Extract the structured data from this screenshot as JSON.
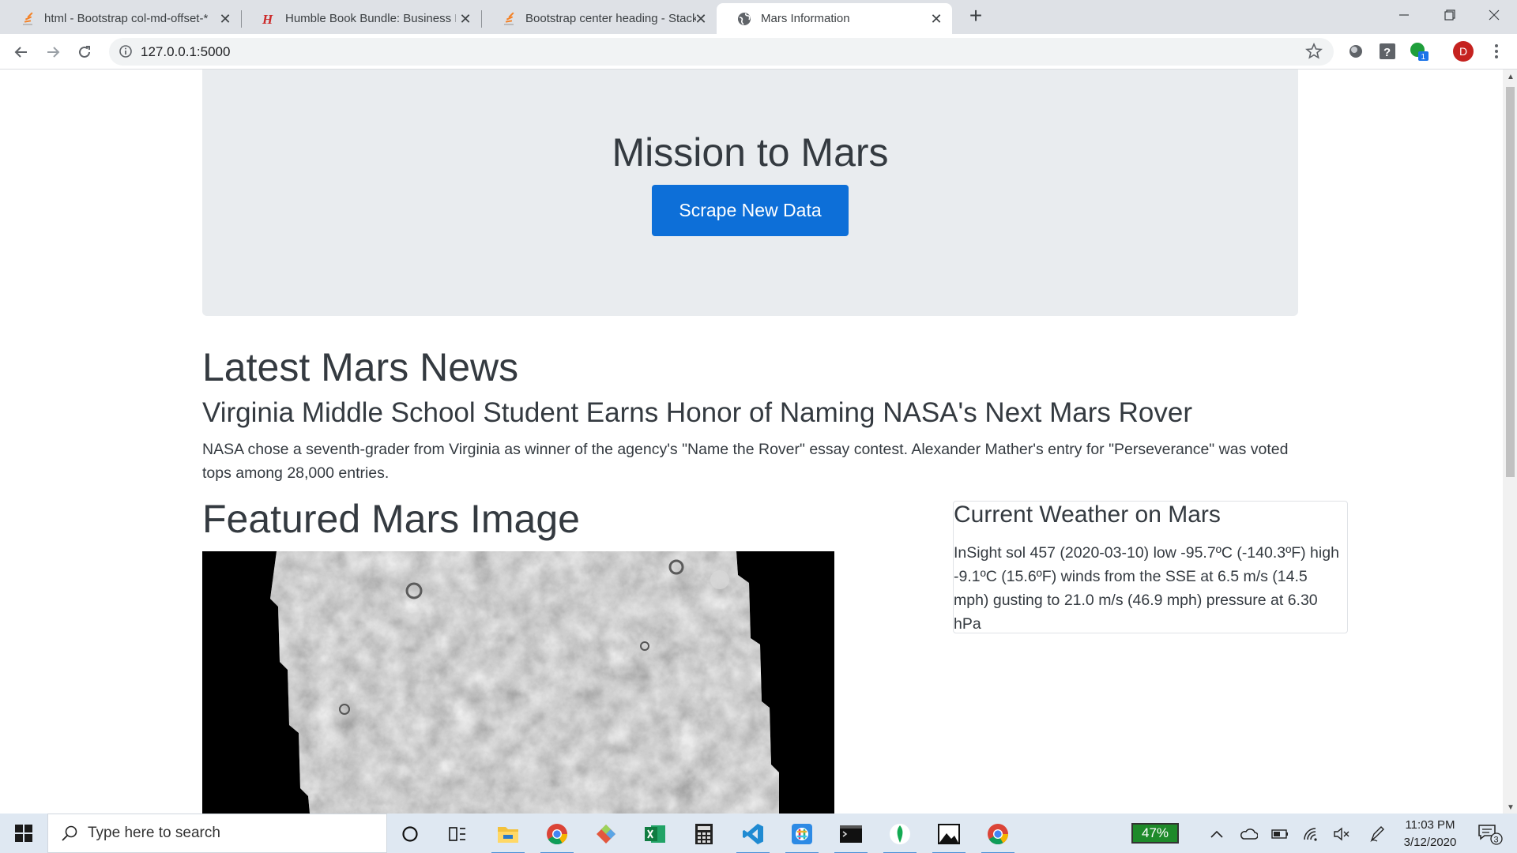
{
  "browser": {
    "tabs": [
      {
        "title": "html - Bootstrap col-md-offset-*",
        "icon": "stackoverflow-icon"
      },
      {
        "title": "Humble Book Bundle: Business In",
        "icon": "humble-icon"
      },
      {
        "title": "Bootstrap center heading - Stack",
        "icon": "stackoverflow-icon"
      },
      {
        "title": "Mars Information",
        "icon": "globe-icon"
      }
    ],
    "url": "127.0.0.1:5000",
    "profile_initial": "D",
    "extension_badge": "1"
  },
  "page": {
    "hero_title": "Mission to Mars",
    "scrape_button": "Scrape New Data",
    "news_heading": "Latest Mars News",
    "news_title": "Virginia Middle School Student Earns Honor of Naming NASA's Next Mars Rover",
    "news_paragraph": "NASA chose a seventh-grader from Virginia as winner of the agency's \"Name the Rover\" essay contest. Alexander Mather's entry for \"Perseverance\" was voted tops among 28,000 entries.",
    "image_heading": "Featured Mars Image",
    "weather_heading": "Current Weather on Mars",
    "weather_text": "InSight sol 457 (2020-03-10) low -95.7ºC (-140.3ºF) high -9.1ºC (15.6ºF) winds from the SSE at 6.5 m/s (14.5 mph) gusting to 21.0 m/s (46.9 mph) pressure at 6.30 hPa"
  },
  "taskbar": {
    "search_placeholder": "Type here to search",
    "battery": "47%",
    "time": "11:03 PM",
    "date": "3/12/2020",
    "notification_count": "3"
  },
  "colors": {
    "primary": "#0d6fd8",
    "jumbotron": "#e9ecef",
    "tabbar": "#dee1e6"
  }
}
